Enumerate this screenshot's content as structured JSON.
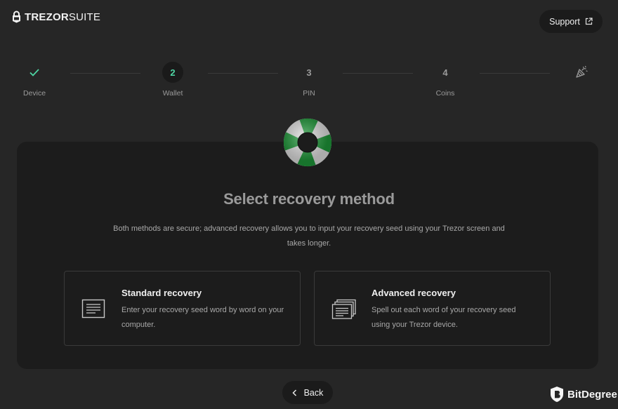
{
  "header": {
    "logo_bold": "TREZOR",
    "logo_light": "SUITE",
    "support_label": "Support"
  },
  "stepper": {
    "steps": [
      {
        "number": "",
        "label": "Device",
        "state": "done"
      },
      {
        "number": "2",
        "label": "Wallet",
        "state": "active"
      },
      {
        "number": "3",
        "label": "PIN",
        "state": "pending"
      },
      {
        "number": "4",
        "label": "Coins",
        "state": "pending"
      },
      {
        "number": "",
        "label": "",
        "state": "final"
      }
    ]
  },
  "main": {
    "title": "Select recovery method",
    "description_line1": "Both methods are secure; advanced recovery allows you to input your recovery seed using your Trezor screen and",
    "description_line2": "takes longer.",
    "options": [
      {
        "title": "Standard recovery",
        "desc_line1": "Enter your recovery seed word by word on your",
        "desc_line2": "computer.",
        "icon": "document-icon"
      },
      {
        "title": "Advanced recovery",
        "desc_line1": "Spell out each word of your recovery seed",
        "desc_line2": "using your Trezor device.",
        "icon": "stacked-documents-icon"
      }
    ]
  },
  "footer": {
    "back_label": "Back"
  },
  "watermark": {
    "text": "BitDegree"
  },
  "colors": {
    "background": "#262626",
    "card": "#1c1c1c",
    "accent": "#4ed6a4",
    "lifebuoy_green": "#1f9a3a"
  }
}
